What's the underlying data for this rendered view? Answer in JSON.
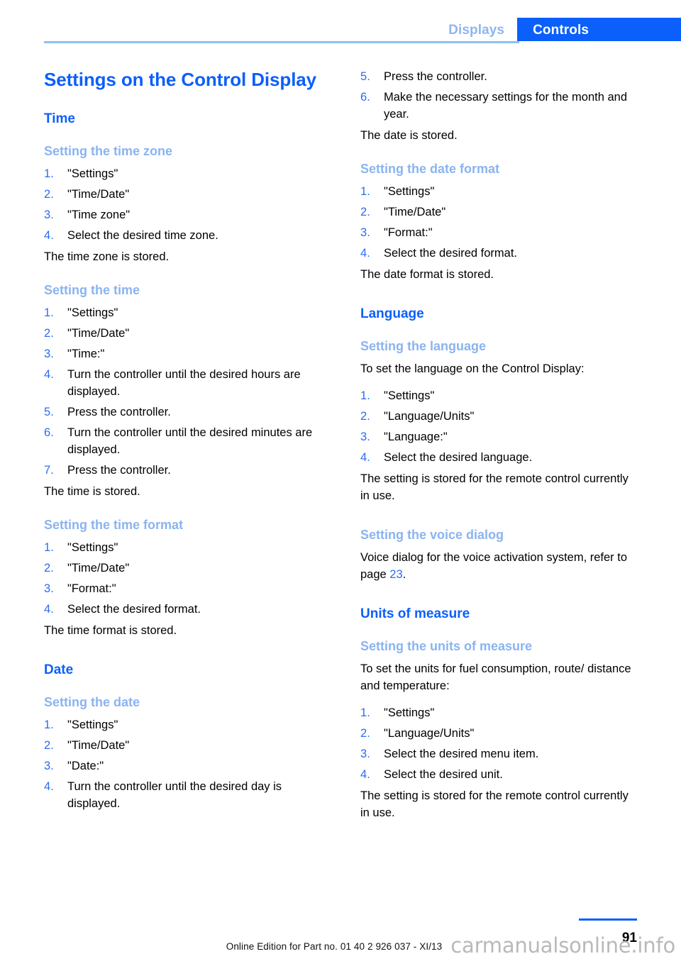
{
  "header": {
    "tabs": [
      {
        "label": "Displays",
        "active": false
      },
      {
        "label": "Controls",
        "active": true
      }
    ],
    "inactive_tab_label": "Displays",
    "active_tab_label": "Controls"
  },
  "chapter_title": "Settings on the Control Display",
  "left_column": {
    "time_section": {
      "title": "Time",
      "time_zone": {
        "subtitle": "Setting the time zone",
        "steps": [
          "\"Settings\"",
          "\"Time/Date\"",
          "\"Time zone\"",
          "Select the desired time zone."
        ],
        "result": "The time zone is stored."
      },
      "time": {
        "subtitle": "Setting the time",
        "steps": [
          "\"Settings\"",
          "\"Time/Date\"",
          "\"Time:\"",
          "Turn the controller until the desired hours are displayed.",
          "Press the controller.",
          "Turn the controller until the desired minutes are displayed.",
          "Press the controller."
        ],
        "result": "The time is stored."
      },
      "time_format": {
        "subtitle": "Setting the time format",
        "steps": [
          "\"Settings\"",
          "\"Time/Date\"",
          "\"Format:\"",
          "Select the desired format."
        ],
        "result": "The time format is stored."
      }
    },
    "date_section": {
      "title": "Date",
      "date": {
        "subtitle": "Setting the date",
        "steps": [
          "\"Settings\"",
          "\"Time/Date\"",
          "\"Date:\"",
          "Turn the controller until the desired day is displayed."
        ]
      }
    }
  },
  "right_column": {
    "date_continued": {
      "steps_start_number": 5,
      "steps": [
        "Press the controller.",
        "Make the necessary settings for the month and year."
      ],
      "result": "The date is stored."
    },
    "date_format": {
      "subtitle": "Setting the date format",
      "steps": [
        "\"Settings\"",
        "\"Time/Date\"",
        "\"Format:\"",
        "Select the desired format."
      ],
      "result": "The date format is stored."
    },
    "language_section": {
      "title": "Language",
      "language": {
        "subtitle": "Setting the language",
        "intro": "To set the language on the Control Display:",
        "steps": [
          "\"Settings\"",
          "\"Language/Units\"",
          "\"Language:\"",
          "Select the desired language."
        ],
        "result": "The setting is stored for the remote control currently in use."
      },
      "voice_dialog": {
        "subtitle": "Setting the voice dialog",
        "text_before": "Voice dialog for the voice activation system, refer to page ",
        "page_ref": "23",
        "text_after": "."
      }
    },
    "units_section": {
      "title": "Units of measure",
      "units": {
        "subtitle": "Setting the units of measure",
        "intro": "To set the units for fuel consumption, route/ distance and temperature:",
        "steps": [
          "\"Settings\"",
          "\"Language/Units\"",
          "Select the desired menu item.",
          "Select the desired unit."
        ],
        "result": "The setting is stored for the remote control currently in use."
      }
    }
  },
  "footer": {
    "page_number": "91",
    "edition_note": "Online Edition for Part no. 01 40 2 926 037 - XI/13",
    "watermark": "carmanualsonline.info"
  },
  "colors": {
    "accent_blue": "#0b5ffb",
    "light_blue": "#8ab4f0",
    "step_number_blue": "#2a6cf4",
    "rule_blue": "#8fc0f0",
    "watermark_gray": "#b9b9b9"
  }
}
